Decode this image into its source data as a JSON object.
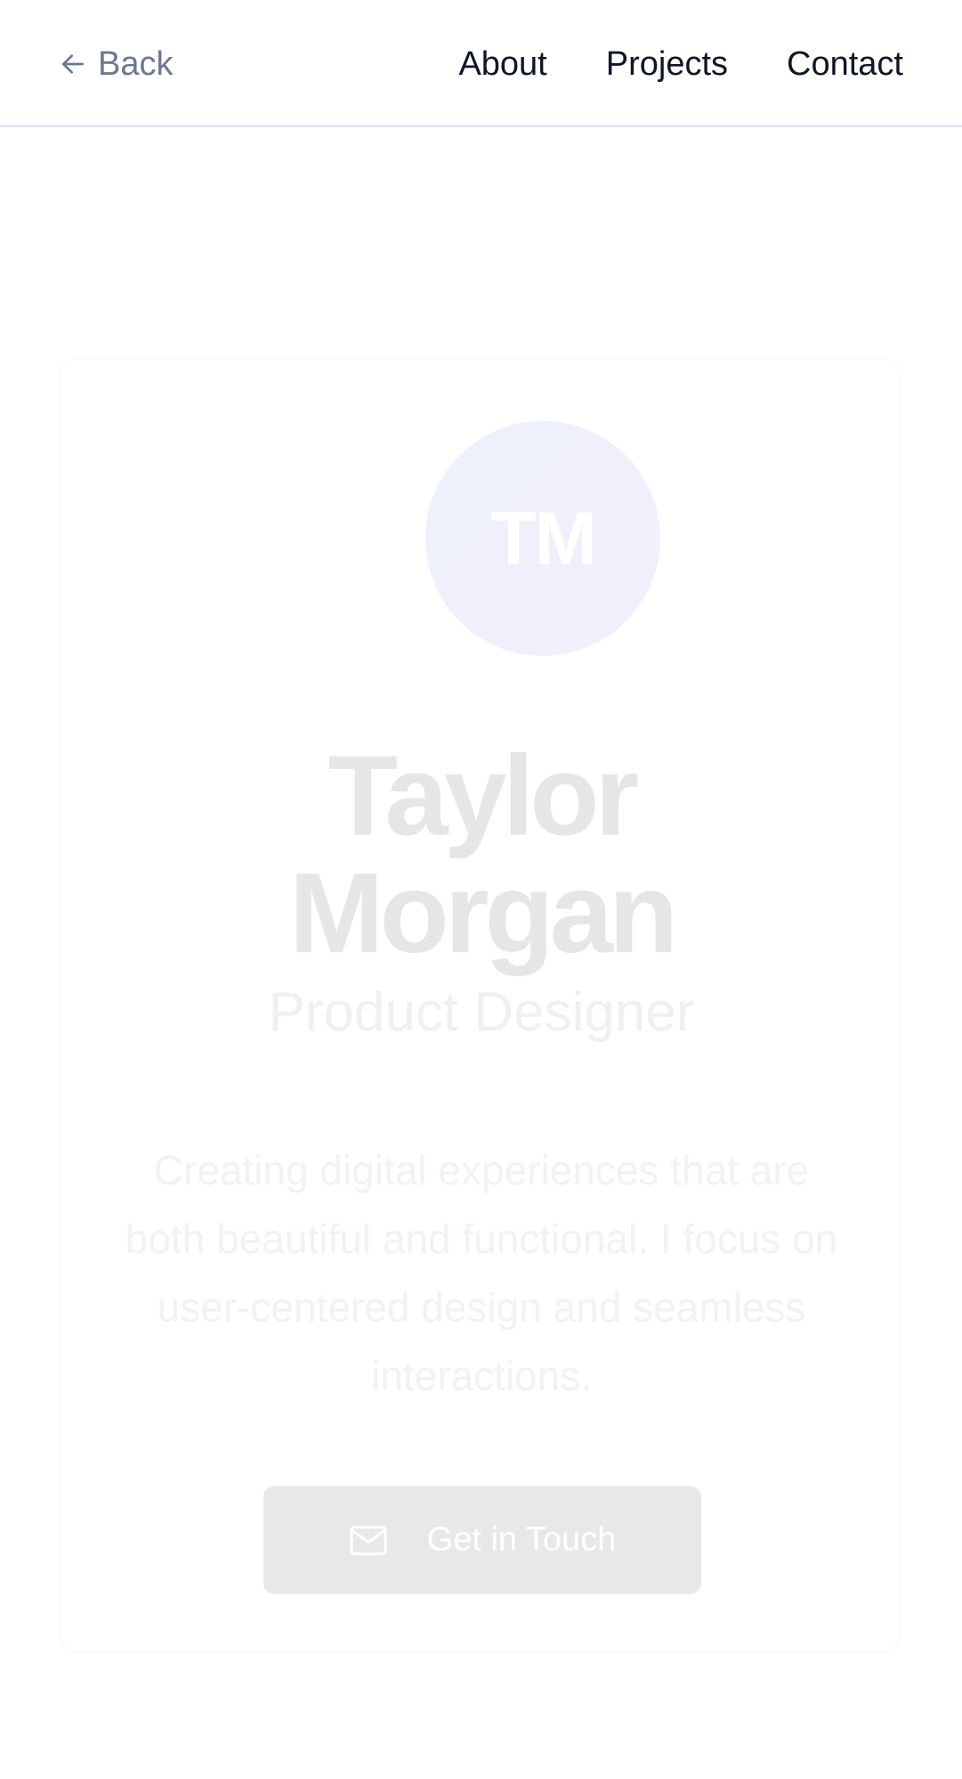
{
  "nav": {
    "back_label": "Back",
    "links": [
      {
        "label": "About"
      },
      {
        "label": "Projects"
      },
      {
        "label": "Contact"
      }
    ]
  },
  "profile": {
    "initials": "TM",
    "name": "Taylor Morgan",
    "name_lines": [
      "Taylor",
      "Morgan"
    ],
    "role": "Product Designer",
    "bio": "Creating digital experiences that are both beautiful and functional. I focus on user-centered design and seamless interactions.",
    "cta_label": "Get in Touch",
    "cta_icon": "mail-icon"
  },
  "icons": {
    "back": "arrow-left-icon",
    "cta": "mail-icon"
  },
  "colors": {
    "nav_text": "#0f1626",
    "back_text": "#6b7891",
    "nav_border": "#e3e9f3",
    "avatar_bg": "#eef0fb",
    "name_text": "#e6e6e7",
    "button_bg": "#e7e8e9"
  }
}
